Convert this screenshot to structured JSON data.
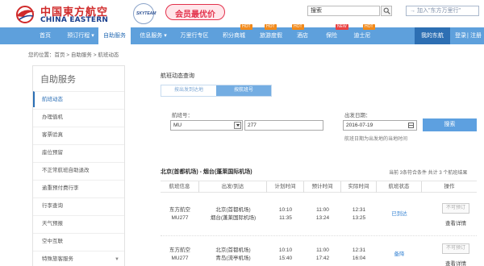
{
  "header": {
    "logo_cn": "中国東方航空",
    "logo_en": "CHINA EASTERN",
    "skyteam": "SKYTEAM",
    "promo": "会员最优价",
    "search_value": "搜索",
    "add_favorite": "加入\"东方万里行\""
  },
  "nav": {
    "items": [
      {
        "label": "首页",
        "badge": ""
      },
      {
        "label": "预订行程 ▾",
        "badge": ""
      },
      {
        "label": "自助服务",
        "badge": ""
      },
      {
        "label": "信息服务 ▾",
        "badge": ""
      },
      {
        "label": "万里行专区",
        "badge": ""
      },
      {
        "label": "积分商城",
        "badge": "HOT"
      },
      {
        "label": "旅游度假",
        "badge": "HOT"
      },
      {
        "label": "酒店",
        "badge": "HOT"
      },
      {
        "label": "保险",
        "badge": "NEW"
      },
      {
        "label": "迪士尼",
        "badge": "HOT"
      }
    ],
    "my_account": "我的东航",
    "login": "登录",
    "register": "注册"
  },
  "breadcrumb": "您的位置：首页 > 自助服务 > 航班动态",
  "sidebar": {
    "title": "自助服务",
    "items": [
      {
        "label": "航班动态",
        "active": true
      },
      {
        "label": "办理值机",
        "active": false
      },
      {
        "label": "客票验真",
        "active": false
      },
      {
        "label": "座位预留",
        "active": false
      },
      {
        "label": "不正常航班自助退改",
        "active": false
      },
      {
        "label": "逾重预付费行李",
        "active": false
      },
      {
        "label": "行李查询",
        "active": false
      },
      {
        "label": "天气预报",
        "active": false
      },
      {
        "label": "空中互联",
        "active": false
      },
      {
        "label": "特殊旅客服务",
        "active": false
      }
    ]
  },
  "query": {
    "title": "航班动态查询",
    "tab_route": "按出发到达地",
    "tab_flight": "按航班号",
    "flight_label": "航班号：",
    "airline_code": "MU",
    "flight_number": "277",
    "date_label": "出发日期：",
    "date_value": "2016-07-19",
    "date_hint": "航班日期为出发地的当地时间",
    "search_button": "搜索"
  },
  "results": {
    "route_title": "北京(首都机场) - 烟台(蓬莱国际机场)",
    "summary": "当前 3条符合条件 共计 3 个航班结果",
    "columns": [
      "航班信息",
      "出发/到达",
      "计划时间",
      "预计时间",
      "实际时间",
      "航班状态",
      "操作"
    ],
    "rows": [
      {
        "airline": "东方航空",
        "flight": "MU277",
        "from": "北京(首都机场)",
        "to": "烟台(蓬莱国际机场)",
        "plan_dep": "10:10",
        "plan_arr": "11:35",
        "est_dep": "11:00",
        "est_arr": "13:24",
        "act_dep": "12:31",
        "act_arr": "13:25",
        "status": "已到达",
        "action_disabled": "不可预订",
        "action_detail": "查看详情"
      },
      {
        "airline": "东方航空",
        "flight": "MU277",
        "from": "北京(首都机场)",
        "to": "青岛(流亭机场)",
        "plan_dep": "10:10",
        "plan_arr": "15:40",
        "est_dep": "11:00",
        "est_arr": "17:42",
        "act_dep": "12:31",
        "act_arr": "16:04",
        "status": "备降",
        "action_disabled": "不可预订",
        "action_detail": "查看详情"
      }
    ]
  },
  "colors": {
    "nav_bg": "#5ea0dc",
    "accent": "#2a6eb5",
    "brand_red": "#d02a2a",
    "button_blue": "#5da0e0"
  }
}
